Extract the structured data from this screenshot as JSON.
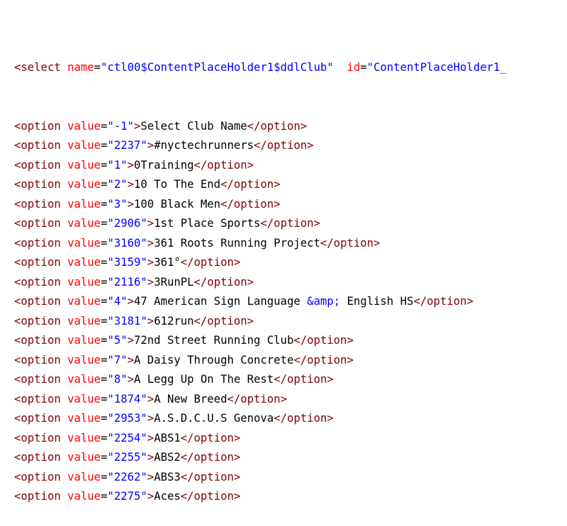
{
  "select_line": {
    "open": "<select",
    "name_attr": "name",
    "name_value": "\"ctl00$ContentPlaceHolder1$ddlClub\"",
    "id_attr": "id",
    "id_value": "\"ContentPlaceHolder1_"
  },
  "option_open": "<option",
  "option_attr": "value",
  "option_close": "</option>",
  "colors": {
    "tag": "#7f0000",
    "attribute": "#ff0000",
    "value": "#0000ff",
    "text": "#000000"
  },
  "options": [
    {
      "value": "\"-1\"",
      "text": "Select Club Name"
    },
    {
      "value": "\"2237\"",
      "text": "#nyctechrunners"
    },
    {
      "value": "\"1\"",
      "text": "0Training"
    },
    {
      "value": "\"2\"",
      "text": "10 To The End"
    },
    {
      "value": "\"3\"",
      "text": "100 Black Men"
    },
    {
      "value": "\"2906\"",
      "text": "1st Place Sports"
    },
    {
      "value": "\"3160\"",
      "text": "361 Roots Running Project"
    },
    {
      "value": "\"3159\"",
      "text": "361°"
    },
    {
      "value": "\"2116\"",
      "text": "3RunPL"
    },
    {
      "value": "\"4\"",
      "text": "47 American Sign Language ",
      "entity": "&amp;",
      "text_after": " English HS"
    },
    {
      "value": "\"3181\"",
      "text": "612run"
    },
    {
      "value": "\"5\"",
      "text": "72nd Street Running Club"
    },
    {
      "value": "\"7\"",
      "text": "A Daisy Through Concrete"
    },
    {
      "value": "\"8\"",
      "text": "A Legg Up On The Rest"
    },
    {
      "value": "\"1874\"",
      "text": "A New Breed"
    },
    {
      "value": "\"2953\"",
      "text": "A.S.D.C.U.S Genova"
    },
    {
      "value": "\"2254\"",
      "text": "ABS1"
    },
    {
      "value": "\"2255\"",
      "text": "ABS2"
    },
    {
      "value": "\"2262\"",
      "text": "ABS3"
    },
    {
      "value": "\"2275\"",
      "text": "Aces"
    }
  ]
}
